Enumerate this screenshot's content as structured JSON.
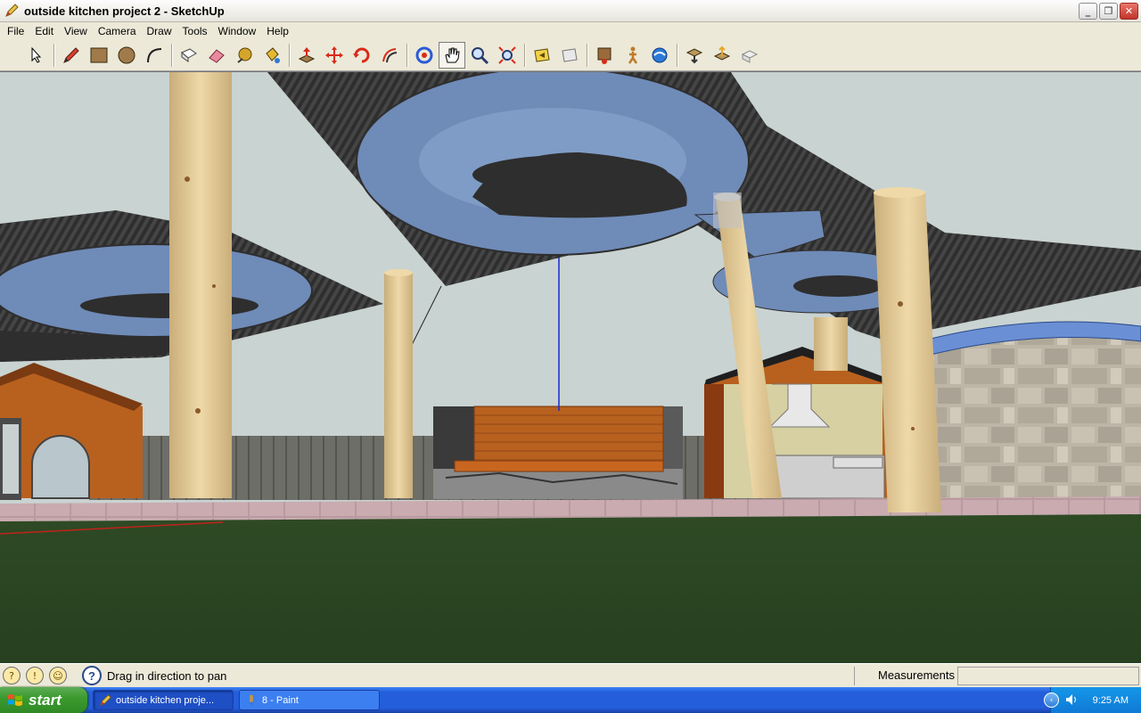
{
  "window": {
    "title": "outside kitchen project 2 - SketchUp",
    "icon": "sketchup-pencil-icon",
    "controls": [
      "minimize",
      "restore",
      "close"
    ]
  },
  "menu": {
    "items": [
      "File",
      "Edit",
      "View",
      "Camera",
      "Draw",
      "Tools",
      "Window",
      "Help"
    ]
  },
  "toolbar": {
    "tools": [
      {
        "name": "select",
        "icon": "arrow-cursor-icon"
      },
      {
        "name": "line",
        "icon": "pencil-icon"
      },
      {
        "name": "rectangle",
        "icon": "rectangle-icon"
      },
      {
        "name": "circle",
        "icon": "circle-icon"
      },
      {
        "name": "arc",
        "icon": "arc-icon"
      },
      {
        "name": "make-component",
        "icon": "component-icon"
      },
      {
        "name": "eraser",
        "icon": "eraser-icon"
      },
      {
        "name": "tape-measure",
        "icon": "tape-measure-icon"
      },
      {
        "name": "paint-bucket",
        "icon": "paint-bucket-icon"
      },
      {
        "name": "push-pull",
        "icon": "push-pull-icon"
      },
      {
        "name": "move",
        "icon": "move-icon"
      },
      {
        "name": "rotate",
        "icon": "rotate-icon"
      },
      {
        "name": "offset",
        "icon": "offset-icon"
      },
      {
        "name": "orbit",
        "icon": "orbit-icon"
      },
      {
        "name": "pan",
        "icon": "pan-hand-icon"
      },
      {
        "name": "zoom",
        "icon": "zoom-icon"
      },
      {
        "name": "zoom-extents",
        "icon": "zoom-extents-icon"
      },
      {
        "name": "previous-view",
        "icon": "previous-view-icon"
      },
      {
        "name": "next-view",
        "icon": "next-view-icon"
      },
      {
        "name": "position-camera",
        "icon": "position-camera-icon"
      },
      {
        "name": "walk",
        "icon": "walk-icon"
      },
      {
        "name": "look-around",
        "icon": "look-around-icon"
      },
      {
        "name": "get-models",
        "icon": "get-models-icon"
      },
      {
        "name": "share-model",
        "icon": "share-model-icon"
      },
      {
        "name": "share-component",
        "icon": "share-component-icon"
      }
    ],
    "active_tool": "pan"
  },
  "statusbar": {
    "instruction": "Drag in direction to pan",
    "measurements_label": "Measurements",
    "measurements_value": ""
  },
  "taskbar": {
    "start_label": "start",
    "tasks": [
      {
        "label": "outside kitchen proje...",
        "icon": "sketchup-pencil-icon",
        "active": true
      },
      {
        "label": "8 - Paint",
        "icon": "paint-icon",
        "active": false
      }
    ],
    "clock": "9:25 AM"
  },
  "colors": {
    "sky": "#c9d3d1",
    "grass": "#2e4a25",
    "canopy": "#2b2b2b",
    "canopy_glass": "#6f8bb8",
    "column": "#e2cb98",
    "wood": "#b8611f",
    "xp_taskbar": "#245edb",
    "xp_start": "#3c9b2f"
  }
}
